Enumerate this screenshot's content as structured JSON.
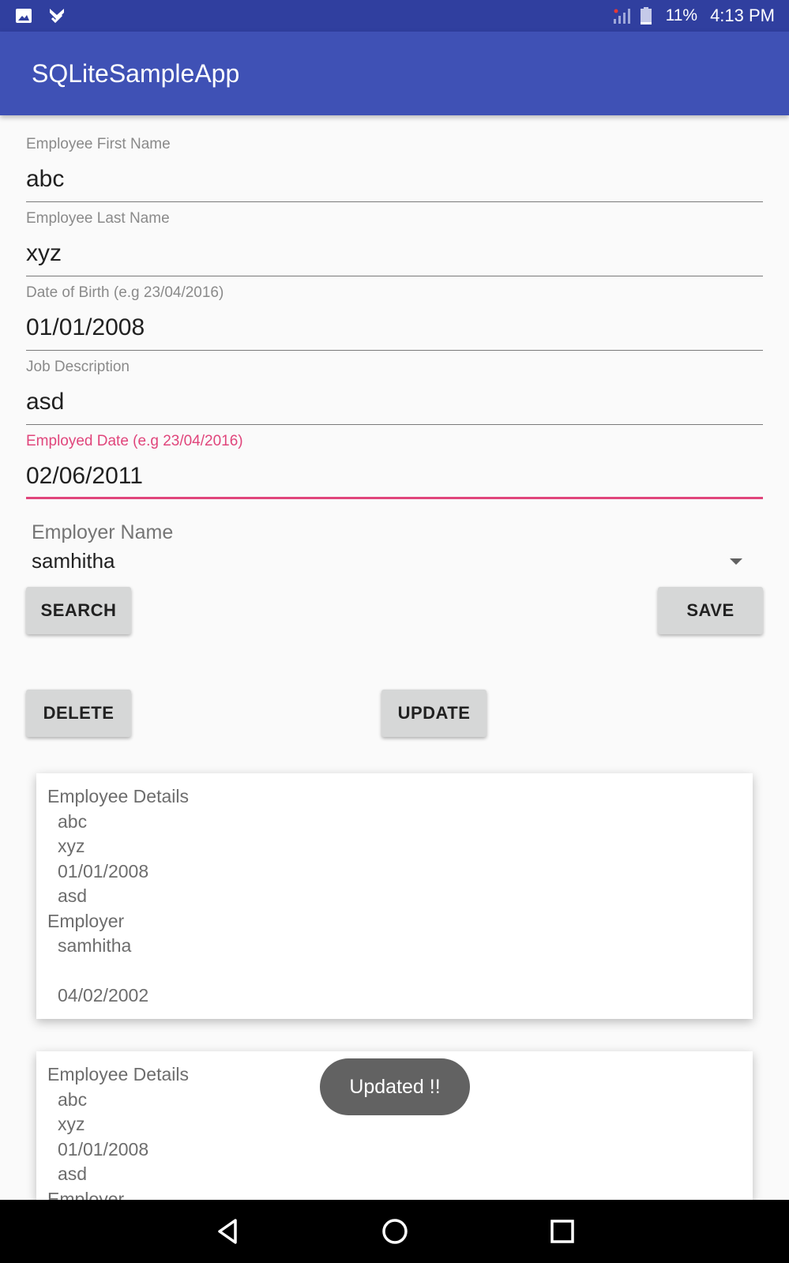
{
  "status_bar": {
    "battery": "11%",
    "time": "4:13 PM",
    "icons": [
      "image-icon",
      "check-notification-icon",
      "signal-icon",
      "battery-icon"
    ]
  },
  "app_bar": {
    "title": "SQLiteSampleApp"
  },
  "form": {
    "first_name": {
      "label": "Employee First Name",
      "value": "abc"
    },
    "last_name": {
      "label": "Employee Last Name",
      "value": "xyz"
    },
    "dob": {
      "label": "Date of Birth (e.g 23/04/2016)",
      "value": "01/01/2008"
    },
    "job": {
      "label": "Job Description",
      "value": "asd"
    },
    "employed_date": {
      "label": "Employed Date (e.g 23/04/2016)",
      "value": "02/06/2011"
    },
    "employer": {
      "label": "Employer Name",
      "value": "samhitha"
    }
  },
  "buttons": {
    "search": "SEARCH",
    "save": "SAVE",
    "delete": "DELETE",
    "update": "UPDATE"
  },
  "cards": [
    {
      "header": "Employee Details",
      "first": "abc",
      "last": "xyz",
      "dob": "01/01/2008",
      "job": "asd",
      "employer_header": "Employer",
      "employer": "samhitha",
      "blank": "",
      "date": "04/02/2002"
    },
    {
      "header": "Employee Details",
      "first": "abc",
      "last": "xyz",
      "dob": "01/01/2008",
      "job": "asd",
      "employer_header": "Employer"
    }
  ],
  "toast": "Updated !!",
  "colors": {
    "status_bar": "#303f9f",
    "app_bar": "#3f51b5",
    "accent": "#e0457b",
    "button": "#d6d7d7",
    "toast": "#626262"
  }
}
